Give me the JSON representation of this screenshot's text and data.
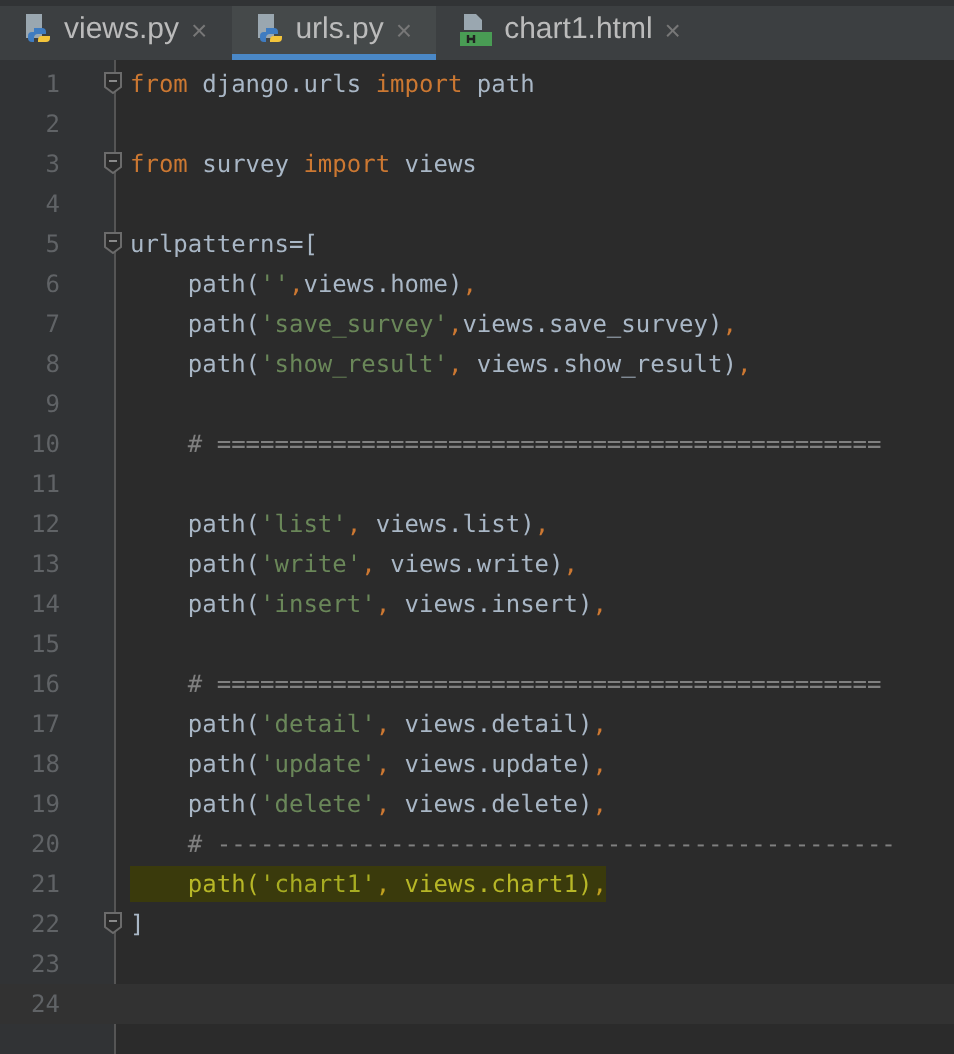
{
  "tabs": [
    {
      "label": "views.py",
      "kind": "python",
      "selected": false,
      "close": "×"
    },
    {
      "label": "urls.py",
      "kind": "python",
      "selected": true,
      "close": "×"
    },
    {
      "label": "chart1.html",
      "kind": "html",
      "selected": false,
      "close": "×"
    }
  ],
  "lines": [
    {
      "number": "1",
      "fold": true,
      "tokens": [
        {
          "kind": "keyword",
          "text": "from"
        },
        {
          "kind": "name",
          "text": " django.urls "
        },
        {
          "kind": "keyword",
          "text": "import"
        },
        {
          "kind": "name",
          "text": " path"
        }
      ]
    },
    {
      "number": "2"
    },
    {
      "number": "3",
      "fold": true,
      "tokens": [
        {
          "kind": "keyword",
          "text": "from"
        },
        {
          "kind": "name",
          "text": " survey "
        },
        {
          "kind": "keyword",
          "text": "import"
        },
        {
          "kind": "name",
          "text": " views"
        }
      ]
    },
    {
      "number": "4"
    },
    {
      "number": "5",
      "fold": true,
      "tokens": [
        {
          "kind": "name",
          "text": "urlpatterns=["
        }
      ]
    },
    {
      "number": "6",
      "tokens": [
        {
          "kind": "name",
          "text": "    path("
        },
        {
          "kind": "string",
          "text": "''"
        },
        {
          "kind": "punct",
          "text": ","
        },
        {
          "kind": "name",
          "text": "views.home)"
        },
        {
          "kind": "punct",
          "text": ","
        }
      ]
    },
    {
      "number": "7",
      "tokens": [
        {
          "kind": "name",
          "text": "    path("
        },
        {
          "kind": "string",
          "text": "'save_survey'"
        },
        {
          "kind": "punct",
          "text": ","
        },
        {
          "kind": "name",
          "text": "views.save_survey)"
        },
        {
          "kind": "punct",
          "text": ","
        }
      ]
    },
    {
      "number": "8",
      "tokens": [
        {
          "kind": "name",
          "text": "    path("
        },
        {
          "kind": "string",
          "text": "'show_result'"
        },
        {
          "kind": "punct",
          "text": ", "
        },
        {
          "kind": "name",
          "text": "views.show_result)"
        },
        {
          "kind": "punct",
          "text": ","
        }
      ]
    },
    {
      "number": "9"
    },
    {
      "number": "10",
      "tokens": [
        {
          "kind": "comment",
          "text": "    # =============================================="
        }
      ]
    },
    {
      "number": "11"
    },
    {
      "number": "12",
      "tokens": [
        {
          "kind": "name",
          "text": "    path("
        },
        {
          "kind": "string",
          "text": "'list'"
        },
        {
          "kind": "punct",
          "text": ", "
        },
        {
          "kind": "name",
          "text": "views.list)"
        },
        {
          "kind": "punct",
          "text": ","
        }
      ]
    },
    {
      "number": "13",
      "tokens": [
        {
          "kind": "name",
          "text": "    path("
        },
        {
          "kind": "string",
          "text": "'write'"
        },
        {
          "kind": "punct",
          "text": ", "
        },
        {
          "kind": "name",
          "text": "views.write)"
        },
        {
          "kind": "punct",
          "text": ","
        }
      ]
    },
    {
      "number": "14",
      "tokens": [
        {
          "kind": "name",
          "text": "    path("
        },
        {
          "kind": "string",
          "text": "'insert'"
        },
        {
          "kind": "punct",
          "text": ", "
        },
        {
          "kind": "name",
          "text": "views.insert)"
        },
        {
          "kind": "punct",
          "text": ","
        }
      ]
    },
    {
      "number": "15"
    },
    {
      "number": "16",
      "tokens": [
        {
          "kind": "comment",
          "text": "    # =============================================="
        }
      ]
    },
    {
      "number": "17",
      "tokens": [
        {
          "kind": "name",
          "text": "    path("
        },
        {
          "kind": "string",
          "text": "'detail'"
        },
        {
          "kind": "punct",
          "text": ", "
        },
        {
          "kind": "name",
          "text": "views.detail)"
        },
        {
          "kind": "punct",
          "text": ","
        }
      ]
    },
    {
      "number": "18",
      "tokens": [
        {
          "kind": "name",
          "text": "    path("
        },
        {
          "kind": "string",
          "text": "'update'"
        },
        {
          "kind": "punct",
          "text": ", "
        },
        {
          "kind": "name",
          "text": "views.update)"
        },
        {
          "kind": "punct",
          "text": ","
        }
      ]
    },
    {
      "number": "19",
      "tokens": [
        {
          "kind": "name",
          "text": "    path("
        },
        {
          "kind": "string",
          "text": "'delete'"
        },
        {
          "kind": "punct",
          "text": ", "
        },
        {
          "kind": "name",
          "text": "views.delete)"
        },
        {
          "kind": "punct",
          "text": ","
        }
      ]
    },
    {
      "number": "20",
      "tokens": [
        {
          "kind": "comment",
          "text": "    # -----------------------------------------------"
        }
      ]
    },
    {
      "number": "21",
      "highlighted": true,
      "tokens": [
        {
          "kind": "name",
          "text": "    path("
        },
        {
          "kind": "string",
          "text": "'chart1'"
        },
        {
          "kind": "punct",
          "text": ", "
        },
        {
          "kind": "name",
          "text": "views.chart1)"
        },
        {
          "kind": "punct",
          "text": ","
        }
      ]
    },
    {
      "number": "22",
      "fold": true,
      "tokens": [
        {
          "kind": "name",
          "text": "]"
        }
      ]
    },
    {
      "number": "23"
    },
    {
      "number": "24"
    }
  ]
}
